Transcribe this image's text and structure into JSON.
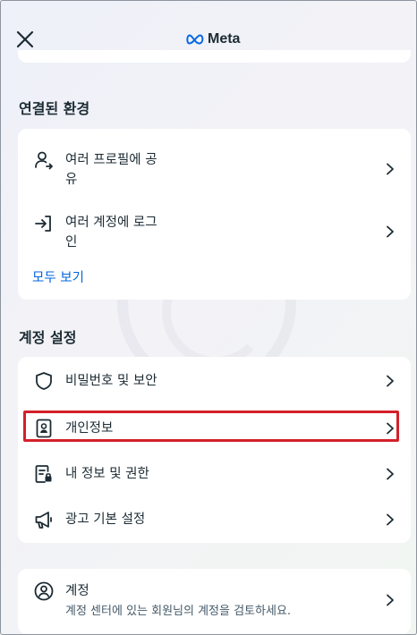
{
  "header": {
    "logo_text": "Meta"
  },
  "connected_experiences": {
    "title": "연결된 환경",
    "items": [
      {
        "label_line1": "여러 프로필에 공",
        "label_line2": "유",
        "icon": "profile-share-icon"
      },
      {
        "label_line1": "여러 계정에 로그",
        "label_line2": "인",
        "icon": "login-arrow-icon"
      }
    ],
    "see_all": "모두 보기"
  },
  "account_settings": {
    "title": "계정 설정",
    "items": [
      {
        "label": "비밀번호 및 보안",
        "icon": "shield-icon"
      },
      {
        "label": "개인정보",
        "icon": "id-card-icon",
        "highlighted": true
      },
      {
        "label": "내 정보 및 권한",
        "icon": "info-permissions-icon"
      },
      {
        "label": "광고 기본 설정",
        "icon": "megaphone-icon"
      }
    ]
  },
  "accounts": {
    "label": "계정",
    "sublabel": "계정 센터에 있는 회원님의 계정을 검토하세요.",
    "icon": "account-circle-icon"
  },
  "colors": {
    "text": "#1c2b33",
    "link": "#0064e0",
    "highlight": "#d4202a"
  }
}
